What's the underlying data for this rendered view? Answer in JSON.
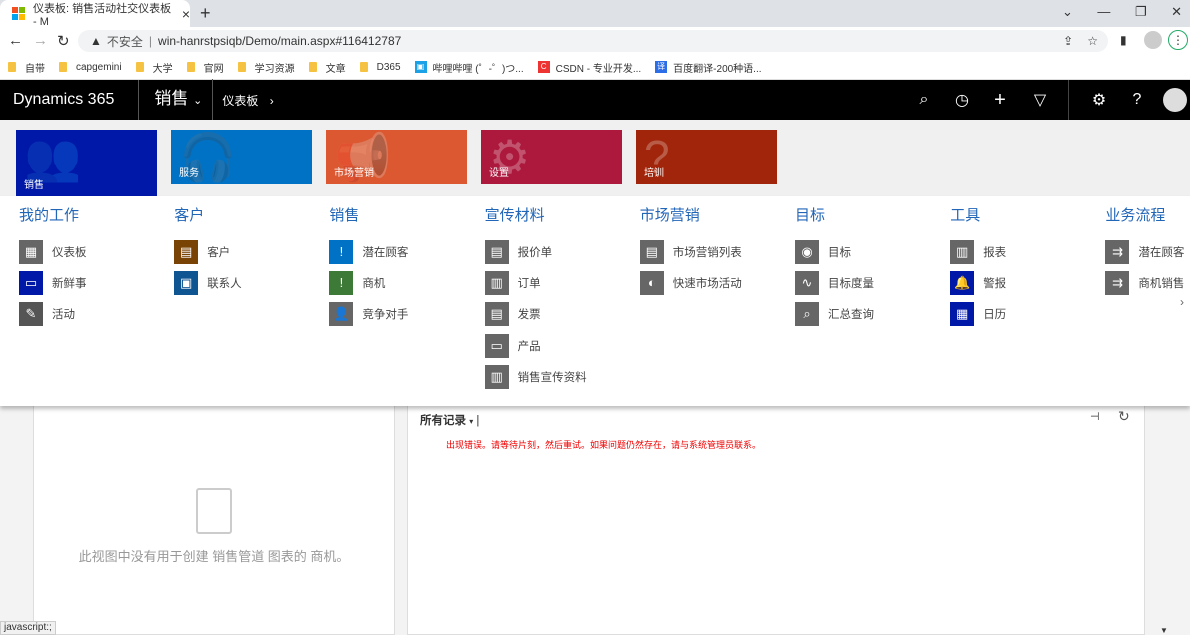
{
  "browser": {
    "tab_title": "仪表板: 销售活动社交仪表板 - M",
    "security": "不安全",
    "url": "win-hanrstpsiqb/Demo/main.aspx#116412787",
    "bookmarks": [
      "自带",
      "capgemini",
      "大学",
      "官网",
      "学习资源",
      "文章",
      "D365",
      "哔哩哔哩 (゜-゜)つ...",
      "CSDN - 专业开发...",
      "百度翻译-200种语..."
    ]
  },
  "nav": {
    "brand": "Dynamics 365",
    "module": "销售",
    "breadcrumb": "仪表板"
  },
  "tiles": [
    {
      "label": "销售",
      "color": "#0018a8"
    },
    {
      "label": "服务",
      "color": "#0072c6"
    },
    {
      "label": "市场营销",
      "color": "#dc5830"
    },
    {
      "label": "设置",
      "color": "#ac193d"
    },
    {
      "label": "培训",
      "color": "#a1250b"
    }
  ],
  "menu": [
    {
      "title": "我的工作",
      "items": [
        {
          "label": "仪表板",
          "color": "#666"
        },
        {
          "label": "新鲜事",
          "color": "#0018a8"
        },
        {
          "label": "活动",
          "color": "#555"
        }
      ]
    },
    {
      "title": "客户",
      "items": [
        {
          "label": "客户",
          "color": "#7a4306"
        },
        {
          "label": "联系人",
          "color": "#0e5592"
        }
      ]
    },
    {
      "title": "销售",
      "items": [
        {
          "label": "潜在顾客",
          "color": "#0072c6"
        },
        {
          "label": "商机",
          "color": "#3e7a37"
        },
        {
          "label": "竞争对手",
          "color": "#666"
        }
      ]
    },
    {
      "title": "宣传材料",
      "items": [
        {
          "label": "报价单",
          "color": "#666"
        },
        {
          "label": "订单",
          "color": "#666"
        },
        {
          "label": "发票",
          "color": "#666"
        },
        {
          "label": "产品",
          "color": "#666"
        },
        {
          "label": "销售宣传资料",
          "color": "#666"
        }
      ]
    },
    {
      "title": "市场营销",
      "items": [
        {
          "label": "市场营销列表",
          "color": "#666"
        },
        {
          "label": "快速市场活动",
          "color": "#666"
        }
      ]
    },
    {
      "title": "目标",
      "items": [
        {
          "label": "目标",
          "color": "#666"
        },
        {
          "label": "目标度量",
          "color": "#666"
        },
        {
          "label": "汇总查询",
          "color": "#666"
        }
      ]
    },
    {
      "title": "工具",
      "items": [
        {
          "label": "报表",
          "color": "#666"
        },
        {
          "label": "警报",
          "color": "#0018a8"
        },
        {
          "label": "日历",
          "color": "#0018a8"
        }
      ]
    },
    {
      "title": "业务流程",
      "items": [
        {
          "label": "潜在顾客",
          "color": "#666"
        },
        {
          "label": "商机销售",
          "color": "#666"
        }
      ]
    }
  ],
  "left_panel": {
    "empty_message": "此视图中没有用于创建 销售管道 图表的 商机。"
  },
  "right_panel": {
    "view_selector": "所有记录",
    "error": "出现错误。请等待片刻，然后重试。如果问题仍然存在，请与系统管理员联系。"
  },
  "status_bar": "javascript:;"
}
